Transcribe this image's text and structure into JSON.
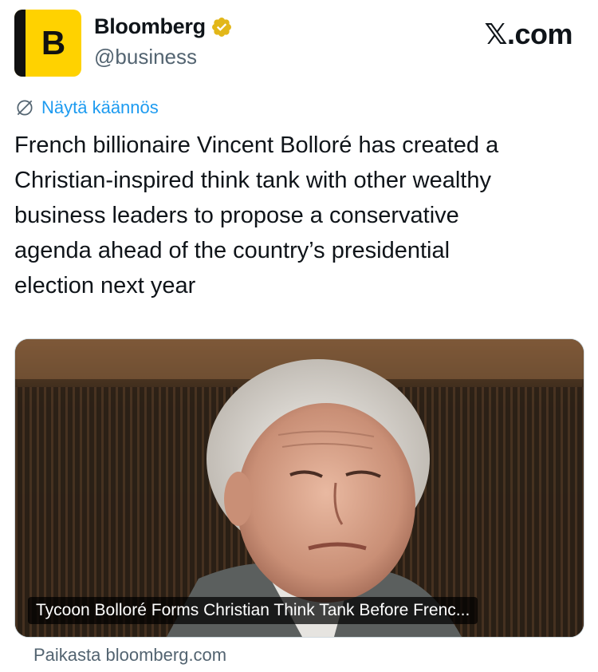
{
  "account": {
    "avatar_letter": "B",
    "display_name": "Bloomberg",
    "handle": "@business",
    "verified_icon": "verified-badge-gold",
    "avatar_color": "#ffd200"
  },
  "brand": {
    "logo_text": "𝕏.com"
  },
  "translate": {
    "label": "Näytä käännös",
    "icon": "globe-slash-icon",
    "color": "#1d9bf0"
  },
  "tweet": {
    "text": "French billionaire Vincent Bolloré has created a\nChristian-inspired think tank with other wealthy\nbusiness leaders to propose a conservative\nagenda ahead of the country’s presidential\nelection next year"
  },
  "card": {
    "title": "Tycoon Bolloré Forms Christian Think Tank Before Frenc...",
    "source": "Paikasta bloomberg.com"
  }
}
